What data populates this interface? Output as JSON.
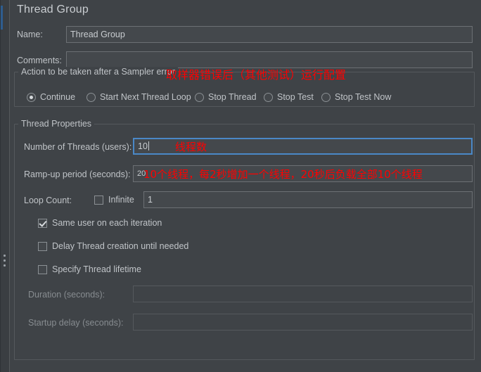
{
  "panel": {
    "title": "Thread Group"
  },
  "fields": {
    "name_label": "Name:",
    "name_value": "Thread Group",
    "comments_label": "Comments:",
    "comments_value": ""
  },
  "sampler_error_group": {
    "legend": "Action to be taken after a Sampler error",
    "options": [
      {
        "label": "Continue",
        "selected": true
      },
      {
        "label": "Start Next Thread Loop",
        "selected": false
      },
      {
        "label": "Stop Thread",
        "selected": false
      },
      {
        "label": "Stop Test",
        "selected": false
      },
      {
        "label": "Stop Test Now",
        "selected": false
      }
    ]
  },
  "thread_properties": {
    "legend": "Thread Properties",
    "num_threads_label": "Number of Threads (users):",
    "num_threads_value": "10",
    "rampup_label": "Ramp-up period (seconds):",
    "rampup_value": "20",
    "loop_count_label": "Loop Count:",
    "infinite_label": "Infinite",
    "infinite_checked": false,
    "loop_count_value": "1",
    "same_user_label": "Same user on each iteration",
    "same_user_checked": true,
    "delay_thread_label": "Delay Thread creation until needed",
    "delay_thread_checked": false,
    "specify_lifetime_label": "Specify Thread lifetime",
    "specify_lifetime_checked": false,
    "duration_label": "Duration (seconds):",
    "duration_value": "",
    "startup_delay_label": "Startup delay (seconds):",
    "startup_delay_value": ""
  },
  "annotations": {
    "sampler_error": "取样器错误后（其他测试）运行配置",
    "num_threads": "线程数",
    "rampup": "10个线程，每2秒增加一个线程，20秒后负载全部10个线程"
  },
  "colors": {
    "background": "#3f4347",
    "field_background": "#44484c",
    "focus_border": "#4a88c7",
    "annotation_red": "#ff0000",
    "text": "#c0c4c8",
    "text_disabled": "#878c90"
  }
}
